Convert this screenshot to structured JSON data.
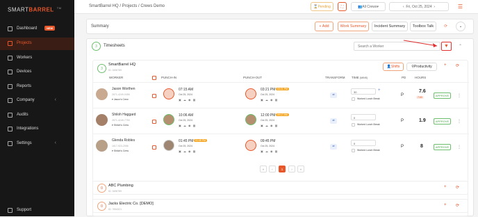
{
  "brand": {
    "name_a": "SMART",
    "name_b": "BARREL",
    "tm": "TM"
  },
  "sidebar": {
    "items": [
      {
        "label": "Dashboard",
        "badge": "NEW"
      },
      {
        "label": "Projects"
      },
      {
        "label": "Workers"
      },
      {
        "label": "Devices"
      },
      {
        "label": "Reports"
      },
      {
        "label": "Company"
      },
      {
        "label": "Audits"
      },
      {
        "label": "Integrations"
      },
      {
        "label": "Settings"
      }
    ],
    "support": "Support"
  },
  "topbar": {
    "breadcrumb": "SmartBarrel HQ  /  Projects  /  Crews Demo",
    "pending": "Pending",
    "crews": "All Crews",
    "date": "Fri, Oct 25, 2024"
  },
  "summary": {
    "title": "Summary",
    "add": "+ Add",
    "work": "Work Summary",
    "incident": "Incident Summary",
    "toolbox": "Toolbox Talk"
  },
  "timesheets": {
    "count": "3",
    "title": "Timesheets",
    "search_placeholder": "Search a Worker"
  },
  "company": {
    "count": "3",
    "name": "SmartBarrel HQ",
    "id": "ID: 3456789",
    "shifts": "Shifts",
    "productivity": "Productivity"
  },
  "headers": {
    "worker": "WORKER",
    "punch_in": "PUNCH-IN",
    "punch_out": "PUNCH-OUT",
    "transform": "TRANSFORM",
    "time": "TIME",
    "time_unit": "(MINS)",
    "pd": "PD",
    "hours": "HOURS"
  },
  "rows": [
    {
      "name": "Jason Worthen",
      "sub": "2671-4249-0456",
      "crew": "Jason's Crew",
      "in_time": "07:15 AM",
      "in_date": "Oct 25, 2024",
      "out_time": "03:21 PM",
      "out_badge": "03:21 PM",
      "out_date": "Oct 25, 2024",
      "mins": "30",
      "lunch": "Worked Lunch Break",
      "pd": "P",
      "hours": "7.6",
      "ot": "7.60",
      "approve": "APPROVE"
    },
    {
      "name": "Shiloh Haggard",
      "sub": "2671-4249-7759",
      "crew": "Shiloh's Crew",
      "in_time": "10:06 AM",
      "in_date": "Oct 25, 2024",
      "out_time": "12:00 PM",
      "out_badge": "09:17 AM",
      "out_date": "Oct 25, 2024",
      "mins": "0",
      "lunch": "Worked Lunch Break",
      "pd": "P",
      "hours": "1.9",
      "ot": "",
      "approve": "APPROVE"
    },
    {
      "name": "Glenda Robles",
      "sub": "1617-923-2056",
      "crew": "Shiloh's Crew",
      "in_time": "01:45 PM",
      "in_badge": "01:45 PM",
      "in_date": "Oct 25, 2024",
      "out_time": "09:45 PM",
      "out_badge": "",
      "out_date": "Oct 25, 2024",
      "mins": "0",
      "lunch": "Worked Lunch Break",
      "pd": "P",
      "hours": "8",
      "ot": "",
      "approve": "APPROVE"
    }
  ],
  "pagination": {
    "page": "1"
  },
  "companies": [
    {
      "count": "0",
      "name": "ABC Plumbing",
      "id": "ID: 3456789"
    },
    {
      "count": "0",
      "name": "Jacks Electric Co. [DEMO]",
      "id": "ID: 7654321"
    }
  ]
}
